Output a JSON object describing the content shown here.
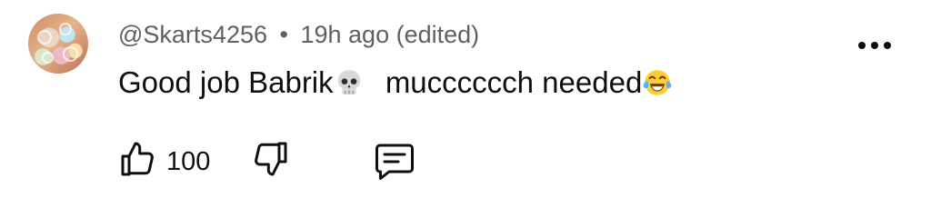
{
  "comment": {
    "author": "@Skarts4256",
    "separator": "•",
    "time": "19h ago",
    "edited_tag": "(edited)",
    "text_part1": "Good job Babrik",
    "text_part2": "mucccccch needed",
    "likes": "100"
  },
  "icons": {
    "menu": "more-vertical-icon",
    "like": "thumbs-up-icon",
    "dislike": "thumbs-down-icon",
    "reply": "comment-icon",
    "emoji1": "skull-emoji",
    "emoji2": "tears-of-joy-emoji"
  },
  "colors": {
    "text_primary": "#0f0f0f",
    "text_secondary": "#606060"
  }
}
